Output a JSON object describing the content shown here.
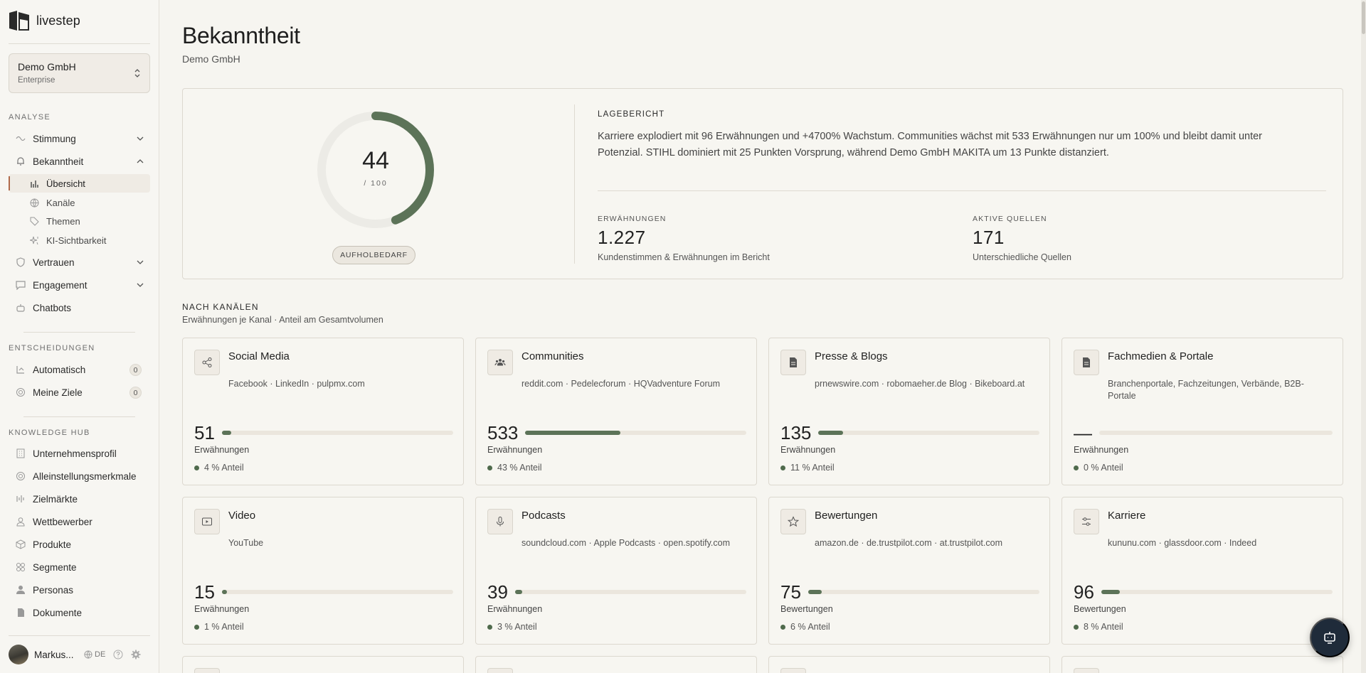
{
  "app": {
    "name": "livestep"
  },
  "org": {
    "name": "Demo GmbH",
    "plan": "Enterprise"
  },
  "sidebar": {
    "sections": {
      "analyse": "ANALYSE",
      "entscheidungen": "ENTSCHEIDUNGEN",
      "knowledge": "KNOWLEDGE HUB"
    },
    "analyse": [
      {
        "label": "Stimmung",
        "icon": "wave-icon",
        "expanded": false
      },
      {
        "label": "Bekanntheit",
        "icon": "bell-icon",
        "expanded": true
      },
      {
        "label": "Vertrauen",
        "icon": "shield-icon",
        "expanded": false
      },
      {
        "label": "Engagement",
        "icon": "chat-icon",
        "expanded": false
      },
      {
        "label": "Chatbots",
        "icon": "bot-icon"
      }
    ],
    "bekanntheit_sub": [
      {
        "label": "Übersicht",
        "icon": "bar-chart-icon",
        "active": true
      },
      {
        "label": "Kanäle",
        "icon": "globe-icon"
      },
      {
        "label": "Themen",
        "icon": "tag-icon"
      },
      {
        "label": "KI-Sichtbarkeit",
        "icon": "sparkle-icon"
      }
    ],
    "entscheidungen": [
      {
        "label": "Automatisch",
        "icon": "flow-icon",
        "count": "0"
      },
      {
        "label": "Meine Ziele",
        "icon": "target-icon",
        "count": "0"
      }
    ],
    "knowledge": [
      {
        "label": "Unternehmensprofil",
        "icon": "building-icon"
      },
      {
        "label": "Alleinstellungsmerkmale",
        "icon": "target-icon"
      },
      {
        "label": "Zielmärkte",
        "icon": "bars-icon"
      },
      {
        "label": "Wettbewerber",
        "icon": "user-icon"
      },
      {
        "label": "Produkte",
        "icon": "box-icon"
      },
      {
        "label": "Segmente",
        "icon": "grid-icon"
      },
      {
        "label": "Personas",
        "icon": "person-icon"
      },
      {
        "label": "Dokumente",
        "icon": "file-icon"
      }
    ],
    "user": {
      "name": "Markus...",
      "lang": "DE"
    }
  },
  "page": {
    "title": "Bekanntheit",
    "subtitle": "Demo GmbH"
  },
  "score": {
    "value": "44",
    "max": "/ 100",
    "fraction": 0.44,
    "status": "AUFHOLBEDARF",
    "color": "#5c7358"
  },
  "report": {
    "title": "LAGEBERICHT",
    "text": "Karriere explodiert mit 96 Erwähnungen und +4700% Wachstum. Communities wächst mit 533 Erwähnungen nur um 100% und bleibt damit unter Potenzial. STIHL dominiert mit 25 Punkten Vorsprung, während Demo GmbH MAKITA um 13 Punkte distanziert.",
    "kpis": [
      {
        "label": "ERWÄHNUNGEN",
        "value": "1.227",
        "desc": "Kundenstimmen & Erwähnungen im Bericht"
      },
      {
        "label": "AKTIVE QUELLEN",
        "value": "171",
        "desc": "Unterschiedliche Quellen"
      }
    ]
  },
  "channels": {
    "title": "NACH KANÄLEN",
    "subtitle": "Erwähnungen je Kanal · Anteil am Gesamtvolumen",
    "cards": [
      {
        "title": "Social Media",
        "icon": "share-icon",
        "sources": "Facebook · LinkedIn · pulpmx.com",
        "value": "51",
        "label": "Erwähnungen",
        "share": "4 % Anteil",
        "fraction": 0.04
      },
      {
        "title": "Communities",
        "icon": "users-icon",
        "sources": "reddit.com · Pedelecforum · HQVadventure Forum",
        "value": "533",
        "label": "Erwähnungen",
        "share": "43 % Anteil",
        "fraction": 0.43
      },
      {
        "title": "Presse & Blogs",
        "icon": "document-icon",
        "sources": "prnewswire.com · robomaeher.de Blog · Bikeboard.at",
        "value": "135",
        "label": "Erwähnungen",
        "share": "11 % Anteil",
        "fraction": 0.11
      },
      {
        "title": "Fachmedien & Portale",
        "icon": "document-icon",
        "sources": "Branchenportale, Fachzeitungen, Verbände, B2B-Portale",
        "value": "—",
        "label": "Erwähnungen",
        "share": "0 % Anteil",
        "fraction": 0
      },
      {
        "title": "Video",
        "icon": "play-icon",
        "sources": "YouTube",
        "value": "15",
        "label": "Erwähnungen",
        "share": "1 % Anteil",
        "fraction": 0.01
      },
      {
        "title": "Podcasts",
        "icon": "mic-icon",
        "sources": "soundcloud.com · Apple Podcasts · open.spotify.com",
        "value": "39",
        "label": "Erwähnungen",
        "share": "3 % Anteil",
        "fraction": 0.03
      },
      {
        "title": "Bewertungen",
        "icon": "star-icon",
        "sources": "amazon.de · de.trustpilot.com · at.trustpilot.com",
        "value": "75",
        "label": "Bewertungen",
        "share": "6 % Anteil",
        "fraction": 0.06
      },
      {
        "title": "Karriere",
        "icon": "sliders-icon",
        "sources": "kununu.com · glassdoor.com · Indeed",
        "value": "96",
        "label": "Bewertungen",
        "share": "8 % Anteil",
        "fraction": 0.08
      }
    ]
  }
}
